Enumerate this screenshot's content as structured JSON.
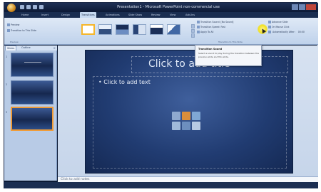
{
  "window": {
    "title": "Presentation1 - Microsoft PowerPoint non-commercial use"
  },
  "ribbon": {
    "tabs": [
      "Home",
      "Insert",
      "Design",
      "Transitions",
      "Animations",
      "Slide Show",
      "Review",
      "View",
      "Add-Ins"
    ],
    "active_tab": "Transitions",
    "preview_group": {
      "item_top": "Preview",
      "item_bottom": "Transition to This Slide",
      "group_label": "Preview"
    },
    "right_group": {
      "transition_sound": "Transition Sound: [No Sound]",
      "transition_speed": "Transition Speed: Fast",
      "apply_to_all": "Apply To All",
      "advance_slide": "Advance Slide",
      "on_mouse_click": "On Mouse Click",
      "automatically_after": "Automatically After:",
      "automatically_value": "00:00",
      "group_label": "Transition to This Slide"
    }
  },
  "tooltip": {
    "title": "Transition Sound",
    "body": "Select a sound to play during the transition between the previous slide and this slide."
  },
  "left_pane": {
    "tabs": [
      "Slides",
      "Outline"
    ],
    "active_tab": "Slides",
    "close_glyph": "×",
    "thumbnail_numbers": [
      "1",
      "2",
      "3"
    ],
    "selected_index": 2
  },
  "slide": {
    "title_placeholder": "Click to add title",
    "body_placeholder": "Click to add text",
    "content_icon_colors": [
      "#8fa9cf",
      "#d98e3c",
      "#7fa7d4",
      "#9fb9d9",
      "#6d8fbf",
      "#b7c9e2"
    ]
  },
  "notes": {
    "placeholder": "Click to add notes"
  },
  "colors": {
    "accent": "#f5b62c",
    "selection": "#f09b36",
    "slide_bg": "#213c72"
  }
}
